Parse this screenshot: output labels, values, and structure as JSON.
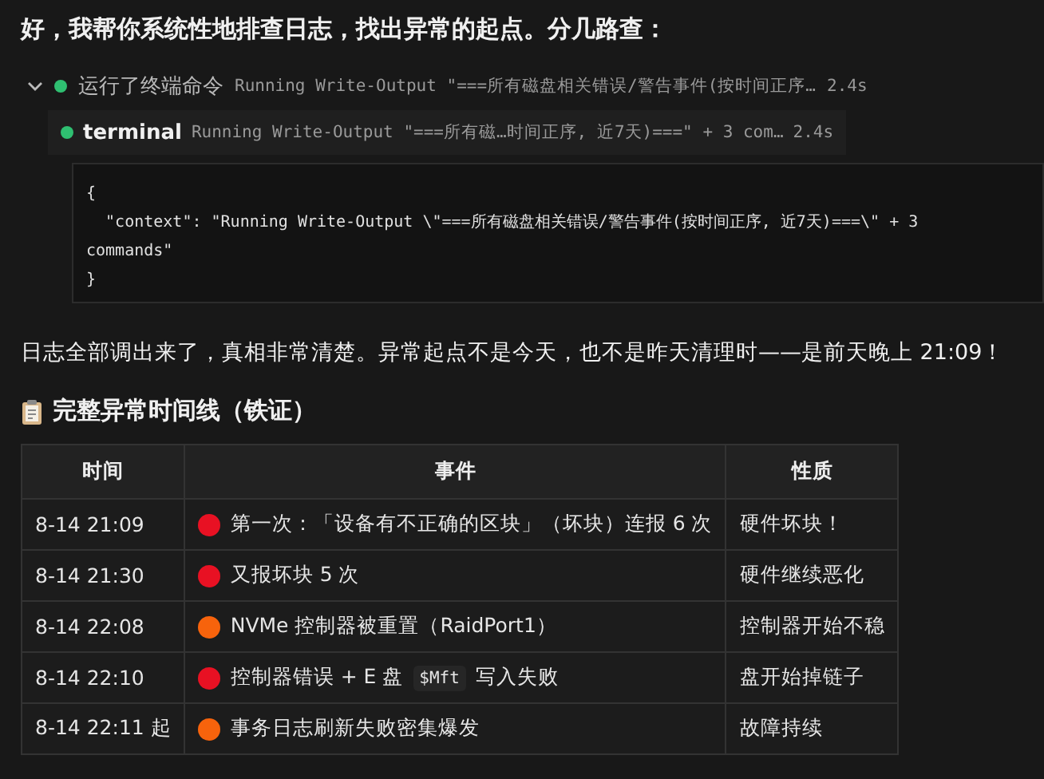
{
  "intro": "好，我帮你系统性地排查日志，找出异常的起点。分几路查：",
  "tool_call": {
    "expanded": true,
    "label": "运行了终端命令",
    "command": "Running Write-Output \"===所有磁盘相关错误/警告事件(按时间正序…",
    "duration": "2.4s"
  },
  "terminal": {
    "title": "terminal",
    "command": "Running Write-Output \"===所有磁…时间正序, 近7天)===\" + 3 com…",
    "duration": "2.4s",
    "code_lines": [
      "{",
      "  \"context\": \"Running Write-Output \\\"===所有磁盘相关错误/警告事件(按时间正序, 近7天)===\\\" + 3",
      "commands\"",
      "}"
    ]
  },
  "summary": "日志全部调出来了，真相非常清楚。异常起点不是今天，也不是昨天清理时——是前天晚上 21:09！",
  "section_title": "完整异常时间线（铁证）",
  "table": {
    "columns": [
      "时间",
      "事件",
      "性质"
    ],
    "rows": [
      {
        "time": "8-14 21:09",
        "color": "#e81123",
        "event": [
          {
            "kind": "text",
            "text": "第一次：「设备有不正确的区块」（坏块）连报 6 次"
          }
        ],
        "nature": "硬件坏块！"
      },
      {
        "time": "8-14 21:30",
        "color": "#e81123",
        "event": [
          {
            "kind": "text",
            "text": "又报坏块 5 次"
          }
        ],
        "nature": "硬件继续恶化"
      },
      {
        "time": "8-14 22:08",
        "color": "#f7630c",
        "event": [
          {
            "kind": "text",
            "text": "NVMe 控制器被重置（RaidPort1）"
          }
        ],
        "nature": "控制器开始不稳"
      },
      {
        "time": "8-14 22:10",
        "color": "#e81123",
        "event": [
          {
            "kind": "text",
            "text": "控制器错误 + E 盘"
          },
          {
            "kind": "code",
            "text": "$Mft"
          },
          {
            "kind": "text",
            "text": "写入失败"
          }
        ],
        "nature": "盘开始掉链子"
      },
      {
        "time": "8-14 22:11 起",
        "color": "#f7630c",
        "event": [
          {
            "kind": "text",
            "text": "事务日志刷新失败密集爆发"
          }
        ],
        "nature": "故障持续"
      }
    ]
  }
}
